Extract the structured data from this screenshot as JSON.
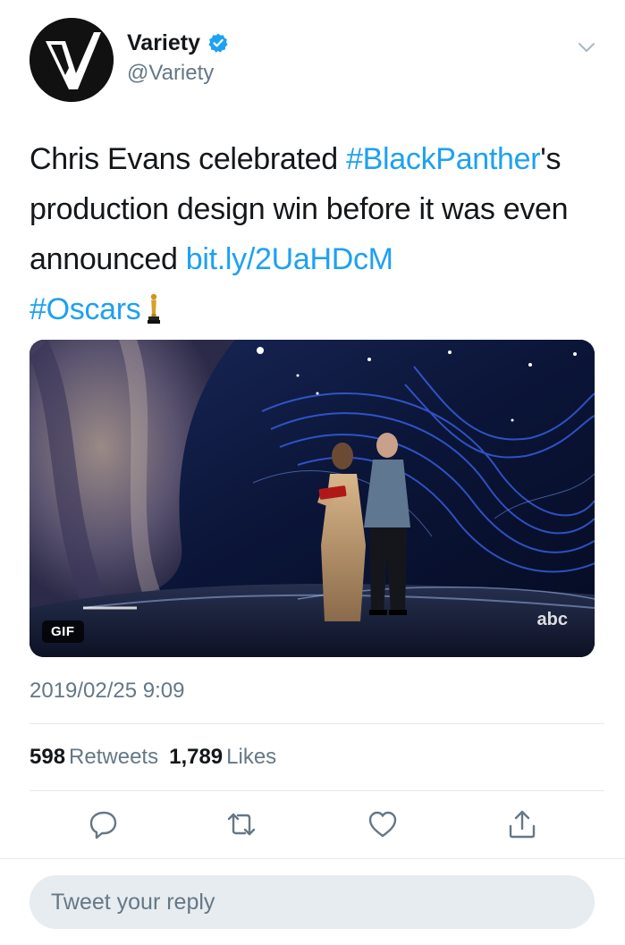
{
  "author": {
    "display_name": "Variety",
    "handle": "@Variety",
    "verified": true,
    "avatar_icon": "variety-v-logo-icon"
  },
  "tweet": {
    "text_parts": {
      "t1": "Chris Evans celebrated ",
      "hashtag1": "#BlackPanther",
      "t2": "'s production design win before it was even announced ",
      "link": "bit.ly/2UaHDcM",
      "hashtag2": "#Oscars"
    },
    "emoji_icon": "oscar-statuette-icon"
  },
  "media": {
    "badge": "GIF",
    "watermark": "abc"
  },
  "timestamp": "2019/02/25 9:09",
  "stats": {
    "retweets_count": "598",
    "retweets_label": "Retweets",
    "likes_count": "1,789",
    "likes_label": "Likes"
  },
  "actions": {
    "reply_icon": "comment-icon",
    "retweet_icon": "retweet-icon",
    "like_icon": "heart-icon",
    "share_icon": "share-icon"
  },
  "reply_box": {
    "placeholder": "Tweet your reply"
  },
  "colors": {
    "link": "#1da1f2",
    "secondary_text": "#657786",
    "primary_text": "#14171a",
    "reply_bg": "#e6ecf0"
  }
}
